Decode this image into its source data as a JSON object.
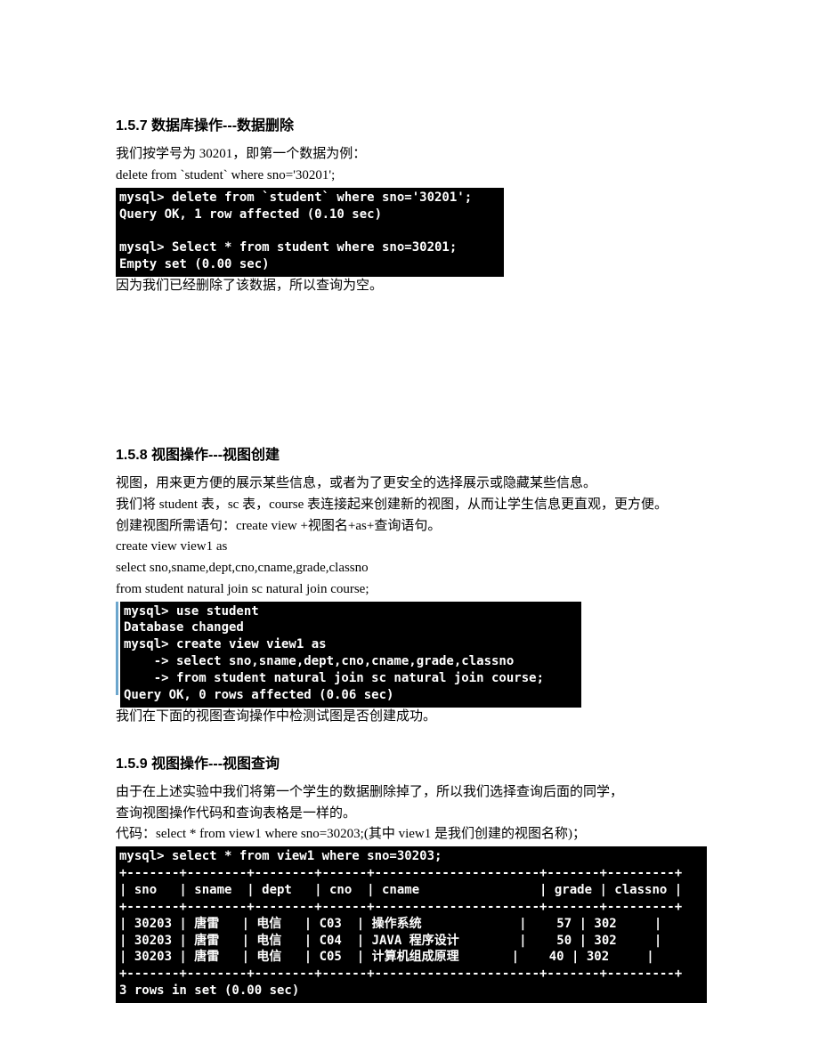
{
  "s157": {
    "heading": "1.5.7  数据库操作---数据删除",
    "p1": "我们按学号为 30201，即第一个数据为例：",
    "p2": "delete from `student` where sno='30201';",
    "term": "mysql> delete from `student` where sno='30201';\nQuery OK, 1 row affected (0.10 sec)\n\nmysql> Select * from student where sno=30201;\nEmpty set (0.00 sec)",
    "p3": "因为我们已经删除了该数据，所以查询为空。"
  },
  "s158": {
    "heading": "1.5.8  视图操作---视图创建",
    "p1": "视图，用来更方便的展示某些信息，或者为了更安全的选择展示或隐藏某些信息。",
    "p2": "我们将 student 表，sc 表，course 表连接起来创建新的视图，从而让学生信息更直观，更方便。",
    "p3": "创建视图所需语句：create view +视图名+as+查询语句。",
    "p4": "create view view1 as",
    "p5": "select sno,sname,dept,cno,cname,grade,classno",
    "p6": "from student natural join sc natural join course;",
    "term": "mysql> use student\nDatabase changed\nmysql> create view view1 as\n    -> select sno,sname,dept,cno,cname,grade,classno\n    -> from student natural join sc natural join course;\nQuery OK, 0 rows affected (0.06 sec)",
    "p7": "我们在下面的视图查询操作中检测试图是否创建成功。"
  },
  "s159": {
    "heading": "1.5.9  视图操作---视图查询",
    "p1": "由于在上述实验中我们将第一个学生的数据删除掉了，所以我们选择查询后面的同学，",
    "p2": "查询视图操作代码和查询表格是一样的。",
    "p3": "代码：select * from view1 where sno=30203;(其中 view1 是我们创建的视图名称)；",
    "term": "mysql> select * from view1 where sno=30203;\n+-------+--------+--------+------+----------------------+-------+---------+\n| sno   | sname  | dept   | cno  | cname                | grade | classno |\n+-------+--------+--------+------+----------------------+-------+---------+\n| 30203 | 唐雷   | 电信   | C03  | 操作系统             |    57 | 302     |\n| 30203 | 唐雷   | 电信   | C04  | JAVA 程序设计        |    50 | 302     |\n| 30203 | 唐雷   | 电信   | C05  | 计算机组成原理       |    40 | 302     |\n+-------+--------+--------+------+----------------------+-------+---------+\n3 rows in set (0.00 sec)"
  }
}
